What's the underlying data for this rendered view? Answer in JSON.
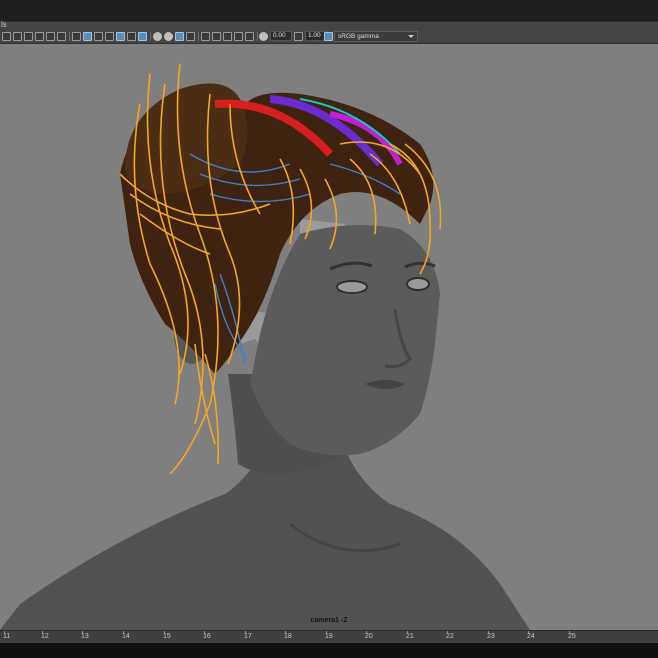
{
  "menubar": {
    "label": "ls"
  },
  "toolbar": {
    "exposure_value": "0.00",
    "gamma_value": "1.00",
    "color_space": "sRGB gamma"
  },
  "viewport": {
    "camera_label": "camera1 -Z"
  },
  "timeline": {
    "ticks": [
      "11",
      "12",
      "13",
      "14",
      "15",
      "16",
      "17",
      "18",
      "19",
      "20",
      "21",
      "22",
      "23",
      "24",
      "25"
    ]
  },
  "colors": {
    "viewport_bg": "#7f7f7f",
    "skin": "#555555",
    "hair_dark": "#4a2a10",
    "guide_orange": "#f5a623",
    "guide_blue": "#3f7fd0",
    "guide_red": "#d81f1f",
    "guide_purple": "#6a2bd0",
    "guide_cyan": "#17c5c5",
    "guide_magenta": "#c21fd0"
  }
}
